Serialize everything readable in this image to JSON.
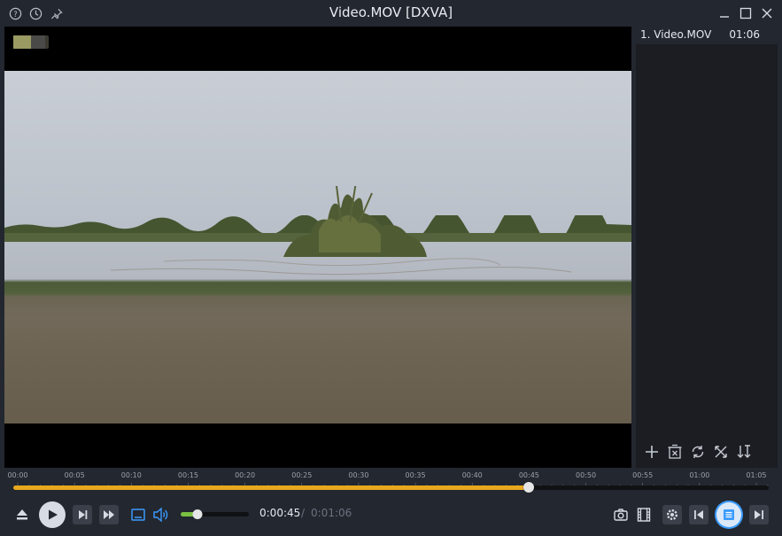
{
  "window": {
    "title": "Video.MOV [DXVA]"
  },
  "playlist": {
    "items": [
      {
        "label": "1. Video.MOV",
        "duration": "01:06"
      }
    ]
  },
  "timeline": {
    "ticks": [
      "00:00",
      "00:05",
      "00:10",
      "00:15",
      "00:20",
      "00:25",
      "00:30",
      "00:35",
      "00:40",
      "00:45",
      "00:50",
      "00:55",
      "01:00",
      "01:05"
    ],
    "tick_seconds": [
      0,
      5,
      10,
      15,
      20,
      25,
      30,
      35,
      40,
      45,
      50,
      55,
      60,
      65
    ],
    "position_seconds": 45,
    "duration_seconds": 66
  },
  "controls": {
    "current_time": "0:00:45",
    "separator": "/",
    "total_time": "0:01:06",
    "volume_level": 0.25
  },
  "colors": {
    "seek_fill": "#e8a81e",
    "volume_fill": "#7bc043",
    "accent_blue": "#3b9cff"
  },
  "icons": {
    "title_left": [
      "help-icon",
      "history-icon",
      "pin-icon"
    ],
    "window": [
      "minimize-icon",
      "maximize-icon",
      "close-icon"
    ],
    "playlist_tools": [
      "add-icon",
      "delete-icon",
      "refresh-icon",
      "shuffle-icon",
      "sort-icon"
    ],
    "transport": [
      "eject-icon",
      "play-icon",
      "next-frame-icon",
      "fast-forward-icon",
      "subtitle-icon",
      "volume-icon"
    ],
    "right": [
      "screenshot-icon",
      "film-icon",
      "settings-icon",
      "previous-icon",
      "playlist-icon",
      "next-icon"
    ]
  }
}
